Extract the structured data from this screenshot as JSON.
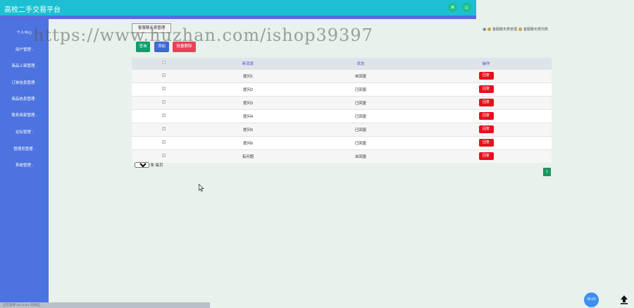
{
  "app": {
    "title": "高校二手交易平台"
  },
  "header": {
    "icon1": "settings-icon",
    "icon2": "user-icon"
  },
  "sidebar": {
    "items": [
      {
        "label": "个人中心"
      },
      {
        "label": "用户管理"
      },
      {
        "label": "商品上架管理"
      },
      {
        "label": "订单信息管理"
      },
      {
        "label": "商品信息管理"
      },
      {
        "label": "联系商家管理"
      },
      {
        "label": "论坛管理"
      },
      {
        "label": "管理员管理"
      },
      {
        "label": "系统管理"
      }
    ]
  },
  "tab": {
    "label": "客服聊天表管理"
  },
  "breadcrumb": {
    "part1": "客服聊天表管理",
    "part2": "客服聊天表列表"
  },
  "actions": {
    "query": "查询",
    "add": "添加",
    "batch_delete": "批量删除"
  },
  "table": {
    "headers": [
      "",
      "新消息",
      "状态",
      "操作"
    ],
    "rows": [
      {
        "message": "提问1",
        "status": "未回复",
        "action": "回复"
      },
      {
        "message": "提问2",
        "status": "已回复",
        "action": "回复"
      },
      {
        "message": "提问3",
        "status": "已回复",
        "action": "回复"
      },
      {
        "message": "提问4",
        "status": "已回复",
        "action": "回复"
      },
      {
        "message": "提问5",
        "status": "已回复",
        "action": "回复"
      },
      {
        "message": "提问6",
        "status": "已回复",
        "action": "回复"
      },
      {
        "message": "有问题",
        "status": "未回复",
        "action": "回复"
      }
    ]
  },
  "pagination": {
    "page_size": "10",
    "page_size_suffix": "条 每页",
    "current_page": "1"
  },
  "statusbar": {
    "text": "正在等待 127.0.0.1 的响应..."
  },
  "clock": {
    "time": "06:20"
  },
  "watermark": {
    "text": "https://www.huzhan.com/ishop39397"
  },
  "colors": {
    "header": "#1cc0d2",
    "sidebar": "#4c73e0",
    "reply_button": "#e6101d",
    "pager": "#1a9660"
  }
}
